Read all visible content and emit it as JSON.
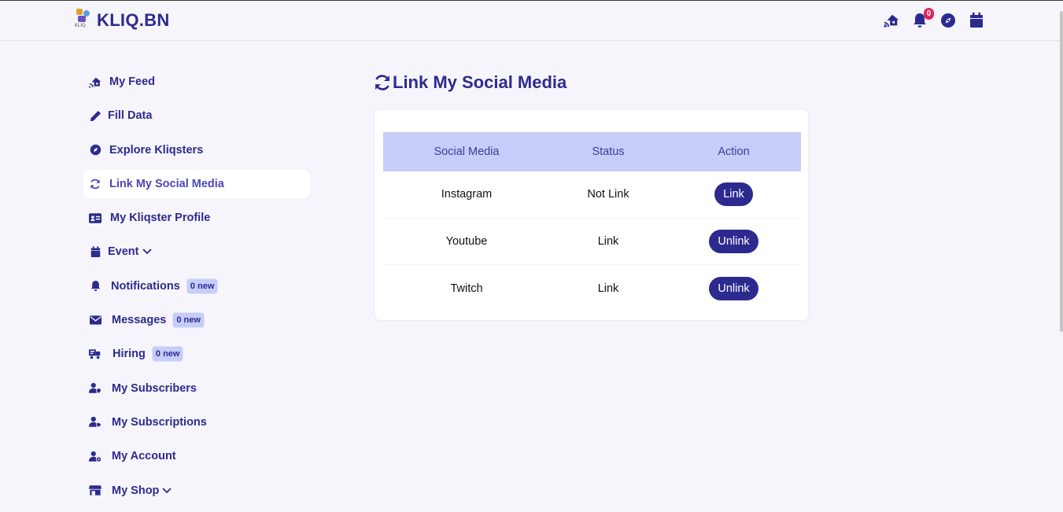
{
  "header": {
    "brand": "KLIQ.BN",
    "logo_text": "KLIQ",
    "notifications_count": "0"
  },
  "sidebar": {
    "items": [
      {
        "label": "My Feed"
      },
      {
        "label": "Fill Data"
      },
      {
        "label": "Explore Kliqsters"
      },
      {
        "label": "Link My Social Media"
      },
      {
        "label": "My Kliqster Profile"
      },
      {
        "label": "Event"
      },
      {
        "label": "Notifications",
        "badge": "0 new"
      },
      {
        "label": "Messages",
        "badge": "0 new"
      },
      {
        "label": "Hiring",
        "badge": "0 new"
      },
      {
        "label": "My Subscribers"
      },
      {
        "label": "My Subscriptions"
      },
      {
        "label": "My Account"
      },
      {
        "label": "My Shop"
      }
    ]
  },
  "main": {
    "title": "Link My Social Media",
    "table": {
      "headers": [
        "Social Media",
        "Status",
        "Action"
      ],
      "rows": [
        {
          "media": "Instagram",
          "status": "Not Link",
          "action": "Link"
        },
        {
          "media": "Youtube",
          "status": "Link",
          "action": "Unlink"
        },
        {
          "media": "Twitch",
          "status": "Link",
          "action": "Unlink"
        }
      ]
    }
  },
  "colors": {
    "primary": "#2d2a8f",
    "table_header": "#c5cdf8",
    "badge": "#e0245e",
    "background": "#f6f5fb"
  }
}
